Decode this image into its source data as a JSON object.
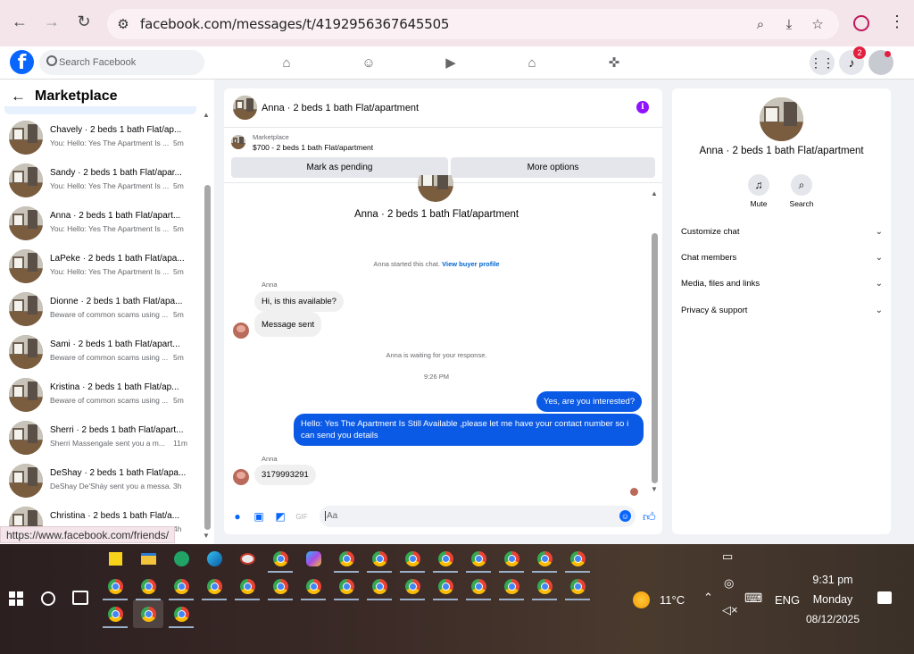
{
  "browser": {
    "url": "facebook.com/messages/t/4192956367645505",
    "status_url": "https://www.facebook.com/friends/"
  },
  "fb": {
    "search_placeholder": "Search Facebook",
    "notification_count": "2",
    "logo": "f"
  },
  "sidebar": {
    "title": "Marketplace",
    "conversations": [
      {
        "name": "Chavely · 2 beds 1 bath Flat/ap...",
        "preview": "You: Hello: Yes The Apartment Is ...",
        "time": "5m"
      },
      {
        "name": "Sandy · 2 beds 1 bath Flat/apar...",
        "preview": "You: Hello: Yes The Apartment Is ...",
        "time": "5m"
      },
      {
        "name": "Anna · 2 beds 1 bath Flat/apart...",
        "preview": "You: Hello: Yes The Apartment Is ...",
        "time": "5m"
      },
      {
        "name": "LaPeke · 2 beds 1 bath Flat/apa...",
        "preview": "You: Hello: Yes The Apartment Is ...",
        "time": "5m"
      },
      {
        "name": "Dionne · 2 beds 1 bath Flat/apa...",
        "preview": "Beware of common scams using ...",
        "time": "5m"
      },
      {
        "name": "Sami · 2 beds 1 bath Flat/apart...",
        "preview": "Beware of common scams using ...",
        "time": "5m"
      },
      {
        "name": "Kristina · 2 beds 1 bath Flat/ap...",
        "preview": "Beware of common scams using ...",
        "time": "5m"
      },
      {
        "name": "Sherri · 2 beds 1 bath Flat/apart...",
        "preview": "Sherri Massengale sent you a m...",
        "time": "11m"
      },
      {
        "name": "DeShay · 2 beds 1 bath Flat/apa...",
        "preview": "DeShay De'Sháy sent you a messa...",
        "time": "3h"
      },
      {
        "name": "Christina · 2 beds 1 bath Flat/a...",
        "preview": "",
        "time": "4h"
      }
    ]
  },
  "chat": {
    "title": "Anna · 2 beds 1 bath Flat/apartment",
    "marketplace_label": "Marketplace",
    "listing": "$700 - 2 beds 1 bath Flat/apartment",
    "mark_pending": "Mark as pending",
    "more_options": "More options",
    "thread_title": "Anna · 2 beds 1 bath Flat/apartment",
    "started_note": "Anna started this chat.",
    "view_profile": "View buyer profile",
    "sender_name": "Anna",
    "msg1": "Hi, is this available?",
    "msg2": "Message sent",
    "waiting_note": "Anna is waiting for your response.",
    "timestamp": "9:26 PM",
    "out1": "Yes, are you interested?",
    "out2": "Hello: Yes The Apartment Is Still Available ,please let me have your contact number so i can send you details",
    "sender_name2": "Anna",
    "msg3": "3179993291",
    "composer_placeholder": "Aa"
  },
  "right_panel": {
    "title": "Anna · 2 beds 1 bath Flat/apartment",
    "mute": "Mute",
    "search": "Search",
    "rows": [
      "Customize chat",
      "Chat members",
      "Media, files and links",
      "Privacy & support"
    ]
  },
  "taskbar": {
    "temperature": "11°C",
    "language": "ENG",
    "time": "9:31 pm",
    "day": "Monday",
    "date": "08/12/2025"
  }
}
